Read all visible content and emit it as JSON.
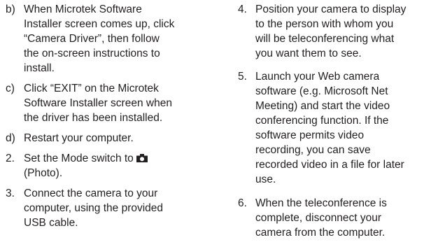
{
  "left_column": [
    {
      "marker": "b)",
      "lines": [
        "When Microtek Software",
        "Installer screen comes up, click",
        "“Camera Driver”, then follow",
        "the on-screen instructions to",
        "install."
      ]
    },
    {
      "marker": "c)",
      "lines": [
        "Click “EXIT” on the Microtek",
        "Software Installer screen when",
        "the driver has been installed."
      ]
    },
    {
      "marker": "d)",
      "lines": [
        "Restart your computer."
      ]
    },
    {
      "marker": "2.",
      "line1": "Set the Mode switch to ",
      "icon": "camera-icon",
      "line2": "(Photo)."
    },
    {
      "marker": "3.",
      "lines": [
        "Connect the camera to your",
        "computer, using the provided",
        "USB cable."
      ]
    }
  ],
  "right_column": [
    {
      "marker": "4.",
      "lines": [
        "Position your camera to display",
        "to the person with whom you",
        "will be teleconferencing what",
        "you want them to see."
      ]
    },
    {
      "marker": "5.",
      "lines": [
        "Launch your Web camera",
        "software (e.g. Microsoft Net",
        "Meeting) and start the video",
        "conferencing function. If the",
        "software permits video",
        "recording, you can save",
        "recorded video in a file for later",
        "use."
      ]
    },
    {
      "marker": "6.",
      "lines": [
        "When the teleconference is",
        "complete, disconnect your",
        "camera from the computer."
      ]
    }
  ]
}
